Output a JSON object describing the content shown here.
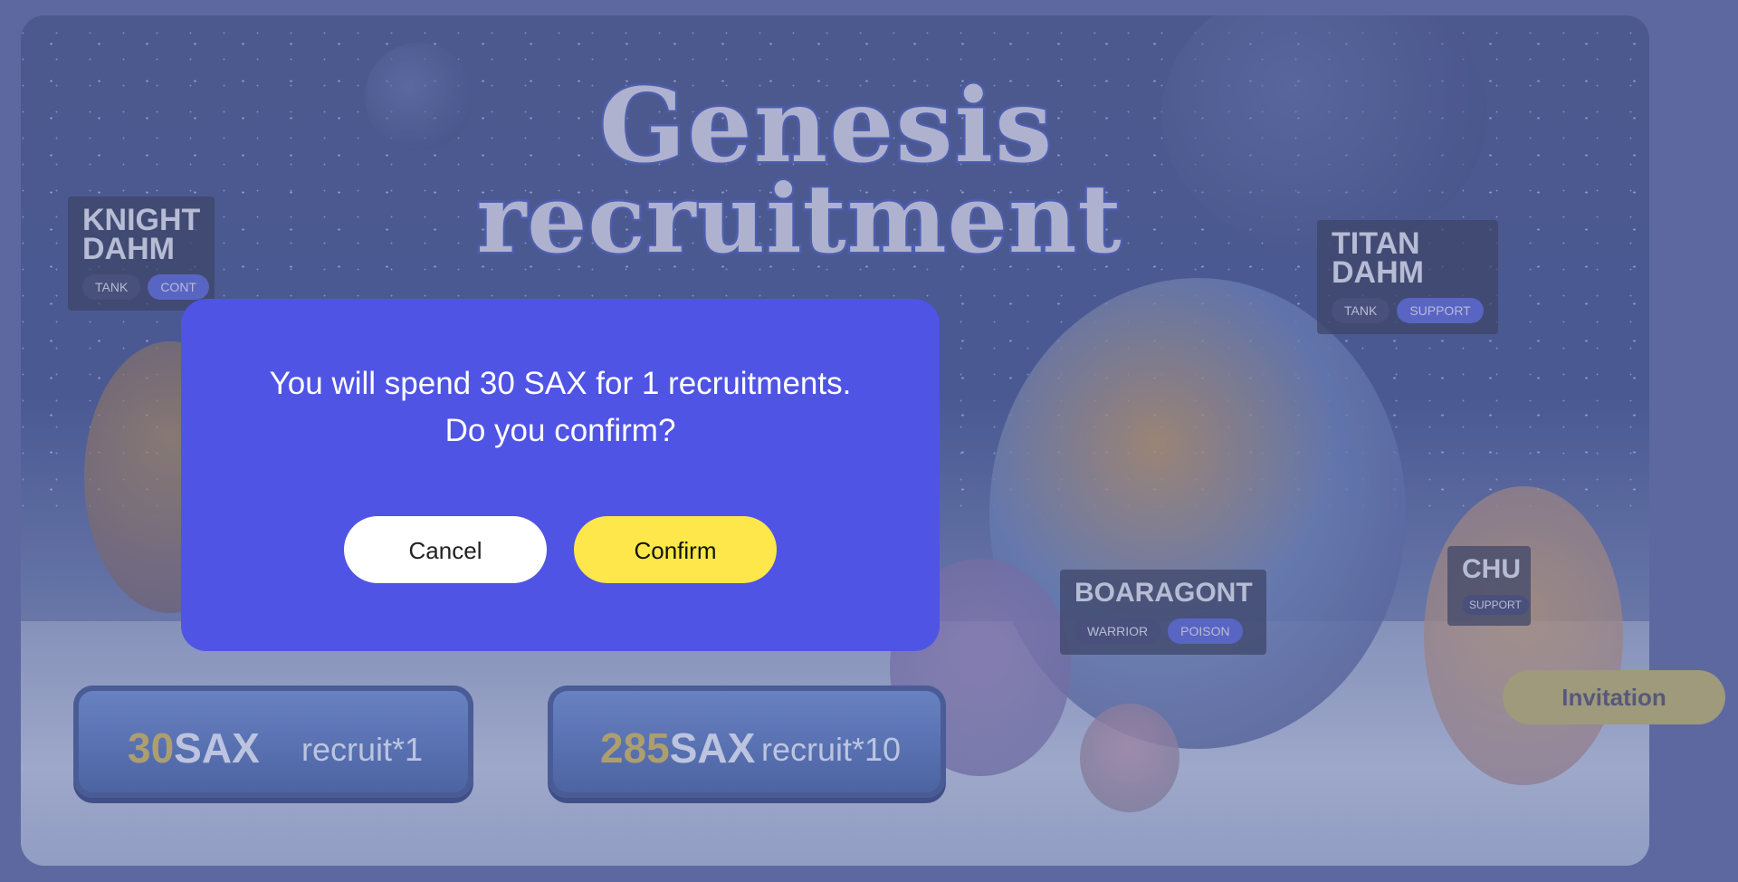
{
  "game": {
    "title_line1": "Genesis",
    "title_line2": "recruitment"
  },
  "heroes": [
    {
      "name": "KNIGHT\nDAHM",
      "tags": [
        "TANK",
        "CONT"
      ]
    },
    {
      "name": "TITAN\nDAHM",
      "tags": [
        "TANK",
        "SUPPORT"
      ]
    },
    {
      "name": "BOARAGONT",
      "tags": [
        "WARRIOR",
        "POISON"
      ]
    },
    {
      "name": "CHU",
      "tags": [
        "SUPPORT"
      ]
    }
  ],
  "recruit_options": [
    {
      "amount": "30",
      "currency": "SAX",
      "label": "recruit*1"
    },
    {
      "amount": "285",
      "currency": "SAX",
      "label": "recruit*10"
    }
  ],
  "invitation_label": "Invitation",
  "dialog": {
    "line1": "You will spend 30 SAX for 1 recruitments.",
    "line2": "Do you confirm?",
    "cancel_label": "Cancel",
    "confirm_label": "Confirm"
  },
  "colors": {
    "dialog_bg": "#4f54e5",
    "confirm_bg": "#fde74a",
    "cancel_bg": "#ffffff",
    "page_bg": "#5f6aa3"
  }
}
